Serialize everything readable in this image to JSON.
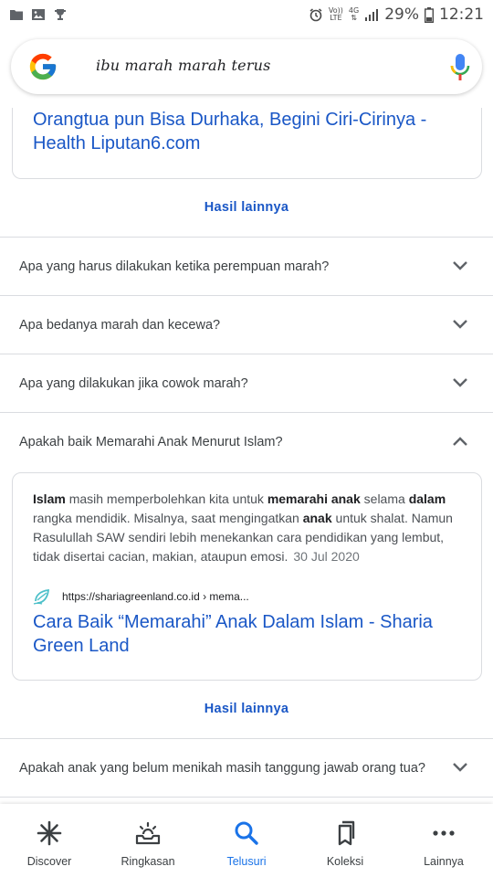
{
  "status_bar": {
    "volte_top": "Vo))",
    "volte_bottom": "LTE",
    "network": "4G",
    "battery_percent": "29%",
    "time": "12:21"
  },
  "search": {
    "query": "ibu marah marah terus"
  },
  "results": {
    "top_card_title": "Orangtua pun Bisa Durhaka, Begini Ciri-Cirinya - Health Liputan6.com",
    "more_label_1": "Hasil lainnya",
    "faqs": [
      {
        "question": "Apa yang harus dilakukan ketika perempuan marah?",
        "expanded": false
      },
      {
        "question": "Apa bedanya marah dan kecewa?",
        "expanded": false
      },
      {
        "question": "Apa yang dilakukan jika cowok marah?",
        "expanded": false
      },
      {
        "question": "Apakah baik Memarahi Anak Menurut Islam?",
        "expanded": true
      }
    ],
    "answer": {
      "bold_1": "Islam",
      "text_1": " masih memperbolehkan kita untuk ",
      "bold_2": "memarahi anak",
      "text_2": " selama ",
      "bold_3": "dalam",
      "text_3": " rangka mendidik. Misalnya, saat mengingatkan ",
      "bold_4": "anak",
      "text_4": " untuk shalat. Namun Rasulullah SAW sendiri lebih menekankan cara pendidikan yang lembut, tidak disertai cacian, makian, ataupun emosi.",
      "date": "30 Jul 2020",
      "source_url": "https://shariagreenland.co.id › mema...",
      "title": "Cara Baik “Memarahi” Anak Dalam Islam - Sharia Green Land"
    },
    "more_label_2": "Hasil lainnya",
    "faq_last": "Apakah anak yang belum menikah masih tanggung jawab orang tua?"
  },
  "bottom_nav": {
    "items": [
      {
        "label": "Discover",
        "icon": "asterisk-icon"
      },
      {
        "label": "Ringkasan",
        "icon": "inbox-sun-icon"
      },
      {
        "label": "Telusuri",
        "icon": "search-icon",
        "active": true
      },
      {
        "label": "Koleksi",
        "icon": "bookmarks-icon"
      },
      {
        "label": "Lainnya",
        "icon": "more-dots-icon"
      }
    ],
    "active_color": "#1a73e8"
  },
  "colors": {
    "link": "#1a57c6",
    "divider": "#dadce0"
  }
}
